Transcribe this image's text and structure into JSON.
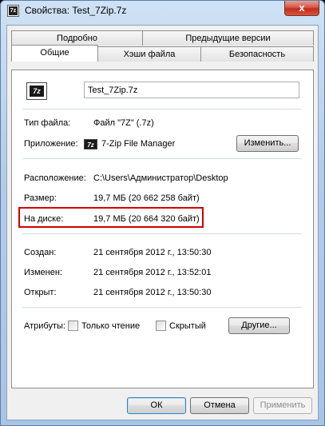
{
  "window": {
    "title": "Свойства: Test_7Zip.7z",
    "icon_text": "7z",
    "close_glyph": "x"
  },
  "tabs": {
    "row1": [
      "Подробно",
      "Предыдущие версии"
    ],
    "row2": [
      "Общие",
      "Хэши файла",
      "Безопасность"
    ]
  },
  "general": {
    "file_icon_text": "7z",
    "file_name": "Test_7Zip.7z",
    "type_label": "Тип файла:",
    "type_value": "Файл \"7Z\" (.7z)",
    "app_label": "Приложение:",
    "app_icon_text": "7z",
    "app_value": "7-Zip File Manager",
    "change_button": "Изменить...",
    "location_label": "Расположение:",
    "location_value": "C:\\Users\\Администратор\\Desktop",
    "size_label": "Размер:",
    "size_value": "19,7 МБ (20 662 258 байт)",
    "disk_label": "На диске:",
    "disk_value": "19,7 МБ (20 664 320 байт)",
    "created_label": "Создан:",
    "created_value": "21 сентября 2012 г., 13:50:30",
    "modified_label": "Изменен:",
    "modified_value": "21 сентября 2012 г., 13:52:01",
    "opened_label": "Открыт:",
    "opened_value": "21 сентября 2012 г., 13:50:30",
    "attributes_label": "Атрибуты:",
    "readonly_label": "Только чтение",
    "hidden_label": "Скрытый",
    "other_button": "Другие..."
  },
  "footer": {
    "ok": "ОК",
    "cancel": "Отмена",
    "apply": "Применить"
  },
  "colors": {
    "highlight": "#d00000",
    "title_bar": "#b3cce8"
  }
}
